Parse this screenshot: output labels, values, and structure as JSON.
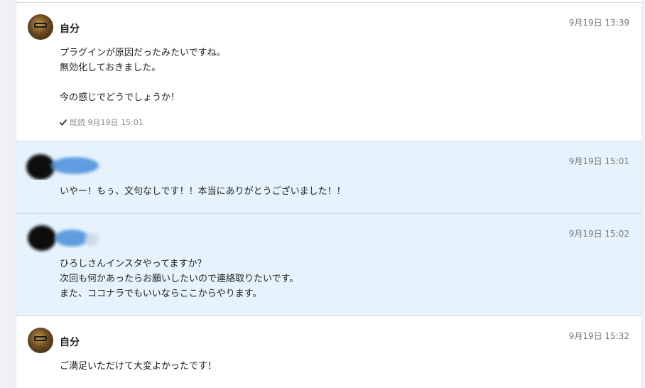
{
  "messages": [
    {
      "sender": "自分",
      "time": "9月19日 13:39",
      "lines": [
        "プラグインが原因だったみたいですね。",
        "無効化しておきました。",
        "",
        "今の感じでどうでしょうか！"
      ],
      "read_label": "既読 9月19日 15:01"
    },
    {
      "time": "9月19日 15:01",
      "lines": [
        "いやー！もぅ、文句なしです！！本当にありがとうございました！！"
      ]
    },
    {
      "time": "9月19日 15:02",
      "lines": [
        "ひろしさんインスタやってますか？",
        "次回も何かあったらお願いしたいので連絡取りたいです。",
        "また、ココナラでもいいならここからやります。"
      ]
    },
    {
      "sender": "自分",
      "time": "9月19日 15:32",
      "lines": [
        "ご満足いただけて大変よかったです！"
      ]
    }
  ],
  "icons": {
    "read_check": "check-icon",
    "self_avatar": "avatar",
    "other_avatar": "redacted-avatar"
  },
  "colors": {
    "self_bg": "#ffffff",
    "other_bg": "#e6f3fd",
    "border": "#d9dce2"
  }
}
